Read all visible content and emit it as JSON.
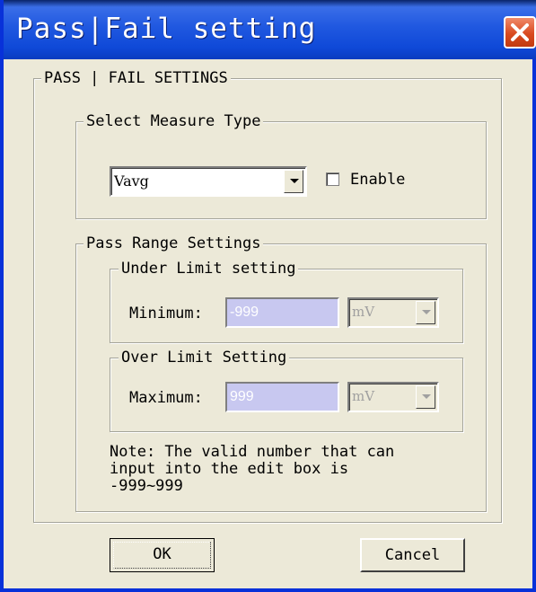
{
  "window": {
    "title": "Pass|Fail setting"
  },
  "group_main": {
    "label": "PASS | FAIL SETTINGS"
  },
  "measure_type": {
    "label": "Select Measure Type",
    "selected": "Vavg",
    "enable_label": "Enable",
    "enable_checked": false
  },
  "pass_range": {
    "label": "Pass Range Settings",
    "under": {
      "label": "Under Limit setting",
      "field_label": "Minimum:",
      "value": "-999",
      "unit": "mV"
    },
    "over": {
      "label": "Over Limit Setting",
      "field_label": "Maximum:",
      "value": "999",
      "unit": "mV"
    },
    "note": "Note: The valid number that can\ninput into the edit box is\n-999~999"
  },
  "buttons": {
    "ok": "OK",
    "cancel": "Cancel"
  },
  "icons": {
    "close": "close-icon",
    "dropdown": "chevron-down-icon"
  },
  "colors": {
    "titlebar": "#0f49d8",
    "close": "#d94a20",
    "disabled_edit": "#c8c8f0",
    "dialog_bg": "#ece9d8"
  }
}
